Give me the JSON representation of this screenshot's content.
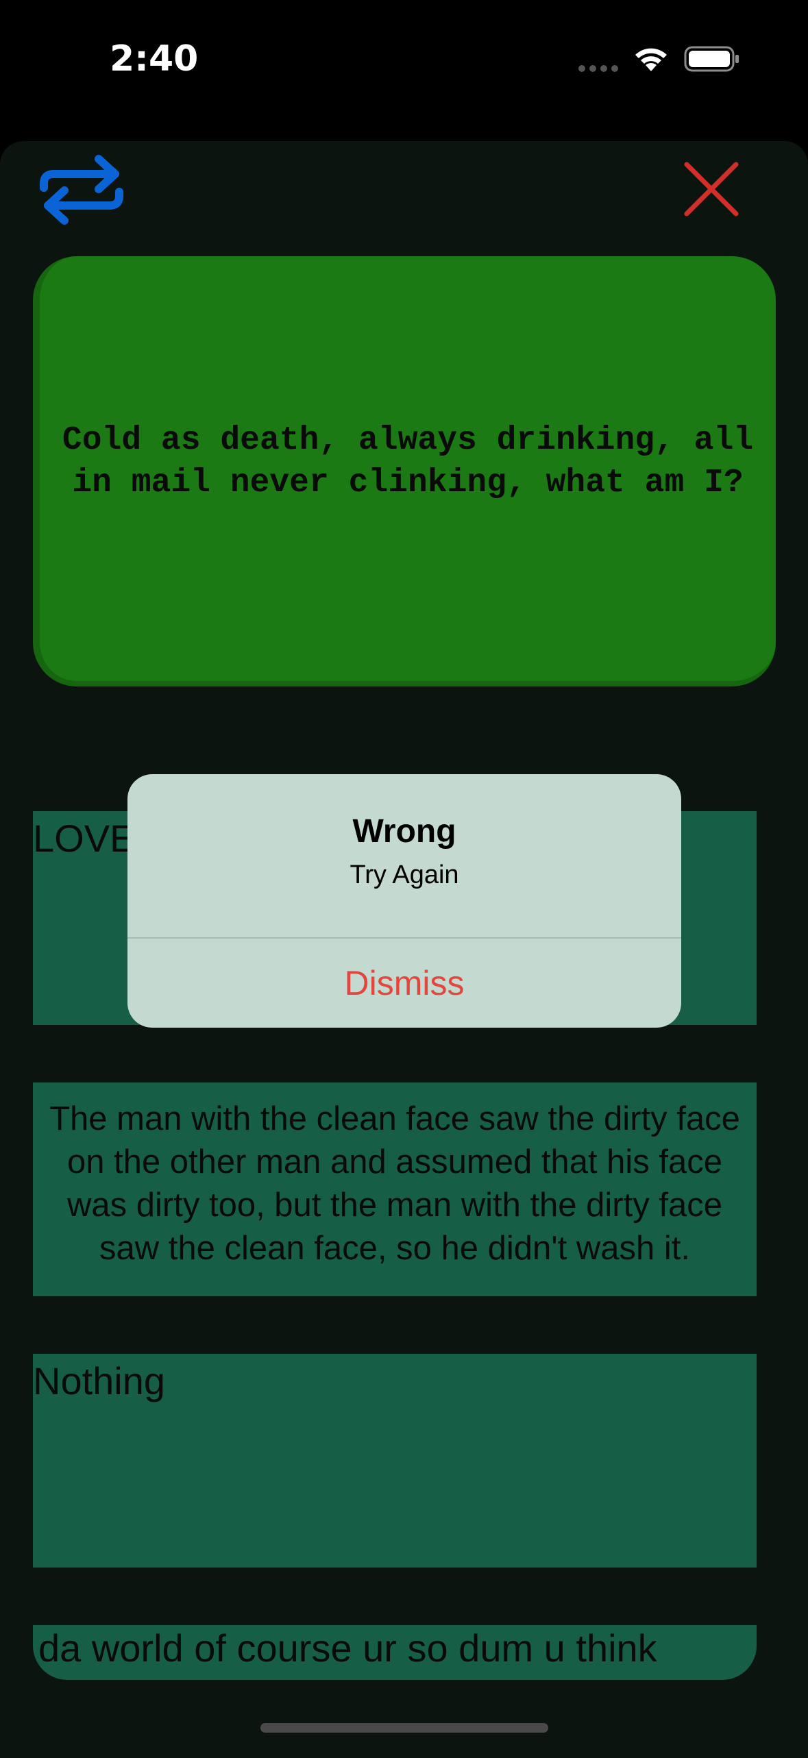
{
  "status_bar": {
    "time": "2:40"
  },
  "toolbar": {
    "swap_icon": "arrow-swap-icon",
    "close_icon": "close-icon"
  },
  "riddle": {
    "text": "Cold as death, always drinking, all in mail never clinking, what am I?"
  },
  "answers": [
    {
      "text": "LOVE"
    },
    {
      "text": "The man with the clean face saw the dirty face on the other man and assumed that his face was dirty too, but the man with the dirty face saw the clean face, so he didn't wash it."
    },
    {
      "text": "Nothing"
    },
    {
      "text": "da world of course ur so dum u think"
    }
  ],
  "alert": {
    "title": "Wrong",
    "message": "Try Again",
    "dismiss_label": "Dismiss"
  },
  "colors": {
    "riddle_card": "#1c7a14",
    "answer_card": "#165f46",
    "swap_icon": "#0a64d6",
    "close_icon": "#d22f28",
    "dismiss": "#e2463c",
    "alert_bg": "#c4dad0"
  }
}
